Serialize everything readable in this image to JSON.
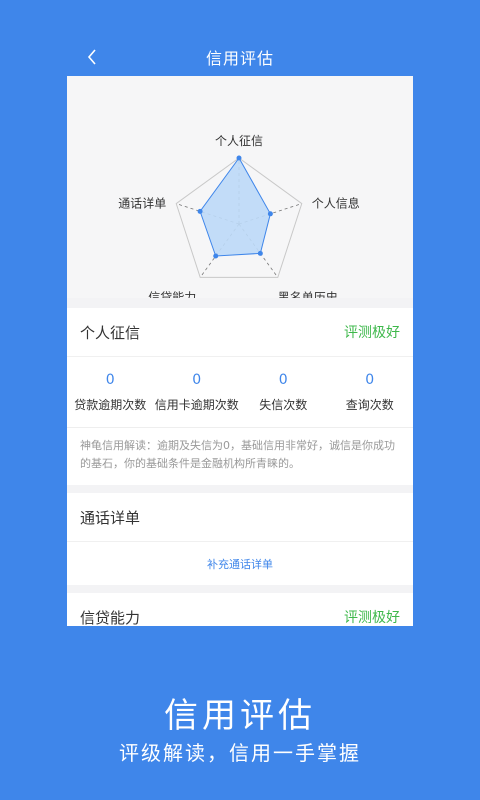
{
  "header": {
    "title": "信用评估"
  },
  "radar": {
    "labels": [
      "个人征信",
      "个人信息",
      "黑名单历史",
      "信贷能力",
      "通话详单"
    ],
    "values": [
      1.0,
      0.5,
      0.55,
      0.6,
      0.62
    ],
    "fill_color": "#bcd9f7",
    "stroke_color": "#3f86ea"
  },
  "credit_card": {
    "title": "个人征信",
    "rating": "评测极好",
    "stats": [
      {
        "value": "0",
        "label": "贷款逾期次数"
      },
      {
        "value": "0",
        "label": "信用卡逾期次数"
      },
      {
        "value": "0",
        "label": "失信次数"
      },
      {
        "value": "0",
        "label": "查询次数"
      }
    ],
    "description": "神龟信用解读：逾期及失信为0，基础信用非常好，诚信是你成功的基石，你的基础条件是金融机构所青睐的。"
  },
  "call_card": {
    "title": "通话详单",
    "link": "补充通话详单"
  },
  "loan_card": {
    "title": "信贷能力",
    "rating": "评测极好"
  },
  "promo": {
    "title": "信用评估",
    "subtitle": "评级解读，信用一手掌握"
  }
}
